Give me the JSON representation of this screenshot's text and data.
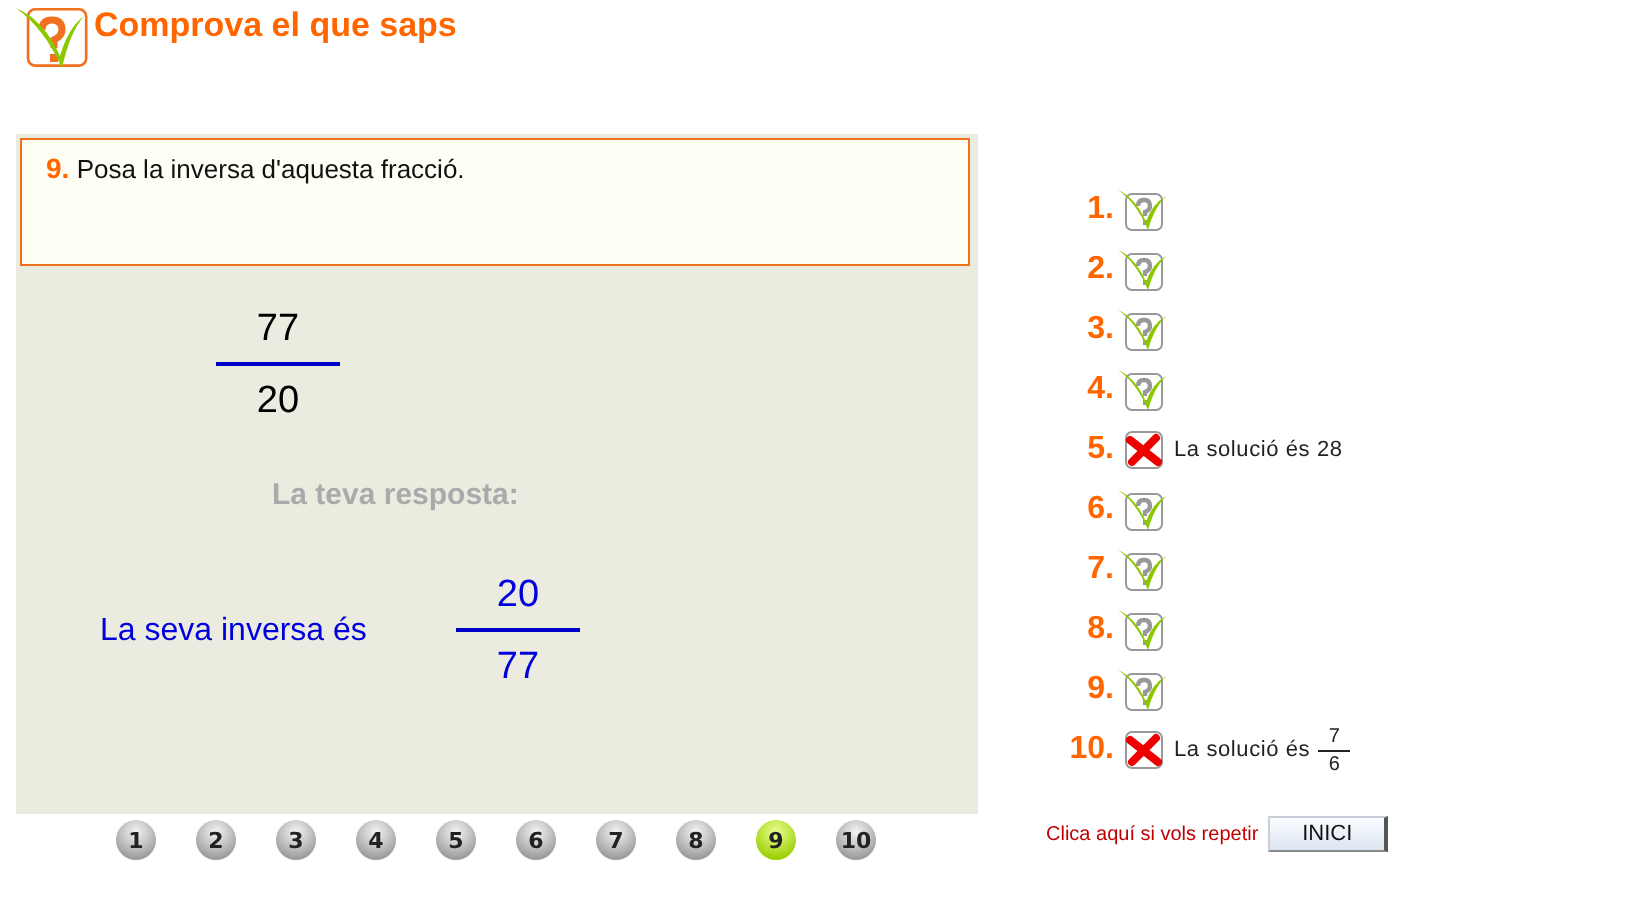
{
  "header": {
    "title": "Comprova el que saps"
  },
  "question": {
    "number": "9.",
    "text": "Posa la inversa d'aquesta fracció.",
    "fraction": {
      "numerator": "77",
      "denominator": "20"
    },
    "answer_label": "La teva resposta:",
    "answer_text": "La seva inversa és",
    "answer_fraction": {
      "numerator": "20",
      "denominator": "77"
    }
  },
  "pager": [
    {
      "label": "1",
      "selected": false
    },
    {
      "label": "2",
      "selected": false
    },
    {
      "label": "3",
      "selected": false
    },
    {
      "label": "4",
      "selected": false
    },
    {
      "label": "5",
      "selected": false
    },
    {
      "label": "6",
      "selected": false
    },
    {
      "label": "7",
      "selected": false
    },
    {
      "label": "8",
      "selected": false
    },
    {
      "label": "9",
      "selected": true
    },
    {
      "label": "10",
      "selected": false
    }
  ],
  "results": [
    {
      "number": "1.",
      "correct": true
    },
    {
      "number": "2.",
      "correct": true
    },
    {
      "number": "3.",
      "correct": true
    },
    {
      "number": "4.",
      "correct": true
    },
    {
      "number": "5.",
      "correct": false,
      "solution": {
        "kind": "number",
        "label": "La solució és",
        "value": "28"
      }
    },
    {
      "number": "6.",
      "correct": true
    },
    {
      "number": "7.",
      "correct": true
    },
    {
      "number": "8.",
      "correct": true
    },
    {
      "number": "9.",
      "correct": true
    },
    {
      "number": "10.",
      "correct": false,
      "solution": {
        "kind": "fraction",
        "label": "La solució és",
        "numerator": "7",
        "denominator": "6"
      }
    }
  ],
  "restart": {
    "text": "Clica aquí si vols repetir",
    "button": "INICI"
  }
}
